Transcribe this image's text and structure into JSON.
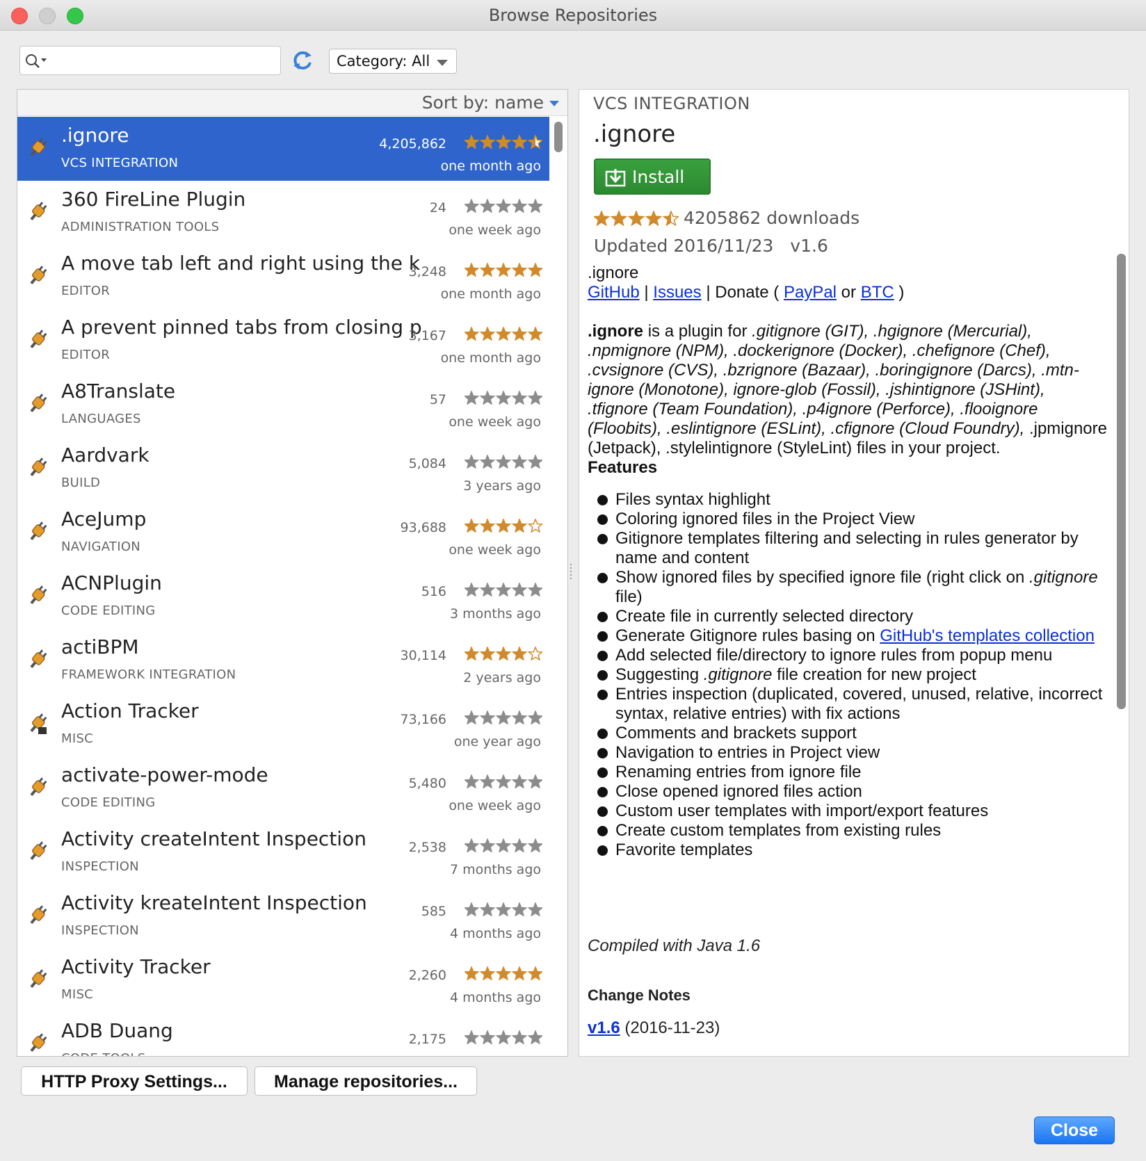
{
  "window": {
    "title": "Browse Repositories"
  },
  "toolbar": {
    "search_value": "",
    "search_icon": "search-icon",
    "refresh_icon": "refresh-icon",
    "category_label": "Category: All"
  },
  "list": {
    "sort_label": "Sort by: name",
    "plugins": [
      {
        "name": ".ignore",
        "category": "VCS INTEGRATION",
        "downloads": "4,205,862",
        "updated": "one month ago",
        "rating": 4.5,
        "selected": true
      },
      {
        "name": "360 FireLine Plugin",
        "category": "ADMINISTRATION TOOLS",
        "downloads": "24",
        "updated": "one week ago",
        "rating": 0
      },
      {
        "name": "A move tab left and right using the k",
        "category": "EDITOR",
        "downloads": "3,248",
        "updated": "one month ago",
        "rating": 5
      },
      {
        "name": "A prevent pinned tabs from closing p",
        "category": "EDITOR",
        "downloads": "3,167",
        "updated": "one month ago",
        "rating": 5
      },
      {
        "name": "A8Translate",
        "category": "LANGUAGES",
        "downloads": "57",
        "updated": "one week ago",
        "rating": 0
      },
      {
        "name": "Aardvark",
        "category": "BUILD",
        "downloads": "5,084",
        "updated": "3 years ago",
        "rating": 0
      },
      {
        "name": "AceJump",
        "category": "NAVIGATION",
        "downloads": "93,688",
        "updated": "one week ago",
        "rating": 4
      },
      {
        "name": "ACNPlugin",
        "category": "CODE EDITING",
        "downloads": "516",
        "updated": "3 months ago",
        "rating": 0
      },
      {
        "name": "actiBPM",
        "category": "FRAMEWORK INTEGRATION",
        "downloads": "30,114",
        "updated": "2 years ago",
        "rating": 4
      },
      {
        "name": "Action Tracker",
        "category": "MISC",
        "downloads": "73,166",
        "updated": "one year ago",
        "rating": 0
      },
      {
        "name": "activate-power-mode",
        "category": "CODE EDITING",
        "downloads": "5,480",
        "updated": "one week ago",
        "rating": 0
      },
      {
        "name": "Activity createIntent Inspection",
        "category": "INSPECTION",
        "downloads": "2,538",
        "updated": "7 months ago",
        "rating": 0
      },
      {
        "name": "Activity kreateIntent Inspection",
        "category": "INSPECTION",
        "downloads": "585",
        "updated": "4 months ago",
        "rating": 0
      },
      {
        "name": "Activity Tracker",
        "category": "MISC",
        "downloads": "2,260",
        "updated": "4 months ago",
        "rating": 5
      },
      {
        "name": "ADB Duang",
        "category": "CODE TOOLS",
        "downloads": "2,175",
        "updated": "",
        "rating": 0
      }
    ]
  },
  "detail": {
    "category": "VCS INTEGRATION",
    "name": ".ignore",
    "install_label": "Install",
    "rating": 4.5,
    "downloads": "4205862 downloads",
    "updated": "Updated 2016/11/23",
    "version": "v1.6",
    "desc_title": ".ignore",
    "links": {
      "github": "GitHub",
      "sep1": "|",
      "issues": "Issues",
      "donate": "| Donate (",
      "paypal": "PayPal",
      "or": "or",
      "btc": "BTC",
      "close_paren": ")"
    },
    "intro_bold": ".ignore",
    "intro_text": "is a plugin for",
    "intro_rest": ".gitignore (GIT), .hgignore (Mercurial), .npmignore (NPM), .dockerignore (Docker), .chefignore (Chef), .cvsignore (CVS), .bzrignore (Bazaar), .boringignore (Darcs), .mtn-ignore (Monotone), ignore-glob (Fossil), .jshintignore (JSHint), .tfignore (Team Foundation), .p4ignore (Perforce), .flooignore (Floobits), .eslintignore (ESLint), .cfignore (Cloud Foundry),",
    "intro_tail": ".jpmignore (Jetpack), .stylelintignore (StyleLint) files in your project.",
    "features_heading": "Features",
    "features": [
      "Files syntax highlight",
      "Coloring ignored files in the Project View",
      "Gitignore templates filtering and selecting in rules generator by name and content",
      "Show ignored files by specified ignore file (right click on",
      "Create file in currently selected directory",
      "Generate Gitignore rules basing on",
      "Add selected file/directory to ignore rules from popup menu",
      "Suggesting",
      "Entries inspection (duplicated, covered, unused, relative, incorrect syntax, relative entries) with fix actions",
      "Comments and brackets support",
      "Navigation to entries in Project view",
      "Renaming entries from ignore file",
      "Close opened ignored files action",
      "Custom user templates with import/export features",
      "Create custom templates from existing rules",
      "Favorite templates"
    ],
    "feature_parts": {
      "show_italic": ".gitignore",
      "show_tail": "file)",
      "generate_link": "GitHub's templates collection",
      "suggest_italic": ".gitignore",
      "suggest_tail": "file creation for new project"
    },
    "compiled": "Compiled with Java 1.6",
    "change_notes": "Change Notes",
    "change_version": "v1.6",
    "change_date": "(2016-11-23)"
  },
  "footer": {
    "proxy_label": "HTTP Proxy Settings...",
    "repos_label": "Manage repositories...",
    "close_label": "Close"
  },
  "colors": {
    "selection": "#2e64cc",
    "star": "#d08a2c",
    "install": "#2f8f34",
    "link": "#0a2fd8"
  }
}
